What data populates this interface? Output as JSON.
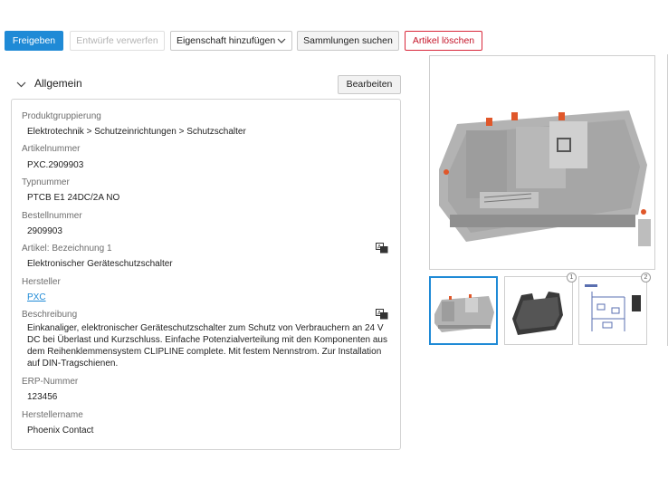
{
  "toolbar": {
    "release_label": "Freigeben",
    "discard_label": "Entwürfe verwerfen",
    "add_property_label": "Eigenschaft hinzufügen",
    "search_collections_label": "Sammlungen suchen",
    "delete_label": "Artikel löschen"
  },
  "section": {
    "title": "Allgemein",
    "edit_label": "Bearbeiten"
  },
  "fields": [
    {
      "label": "Produktgruppierung",
      "value": "Elektrotechnik > Schutzeinrichtungen > Schutzschalter"
    },
    {
      "label": "Artikelnummer",
      "value": "PXC.2909903"
    },
    {
      "label": "Typnummer",
      "value": "PTCB E1 24DC/2A NO"
    },
    {
      "label": "Bestellnummer",
      "value": "2909903"
    },
    {
      "label": "Artikel: Bezeichnung 1",
      "value": "Elektronischer Geräteschutzschalter"
    },
    {
      "label": "Hersteller",
      "value": "PXC"
    },
    {
      "label": "Beschreibung",
      "value": "Einkanaliger, elektronischer Geräteschutzschalter zum Schutz von Verbrauchern an 24 V DC bei Überlast und Kurzschluss. Einfache Potenzialverteilung mit den Komponenten aus dem Reihenklemmensystem CLIPLINE complete. Mit festem Nennstrom. Zur Installation auf DIN-Tragschienen."
    },
    {
      "label": "ERP-Nummer",
      "value": "123456"
    },
    {
      "label": "Herstellername",
      "value": "Phoenix Contact"
    }
  ],
  "thumbnails": [
    {
      "badge": ""
    },
    {
      "badge": "1"
    },
    {
      "badge": "2"
    }
  ],
  "colors": {
    "primary": "#1f8ad6",
    "danger": "#d9293b",
    "device_gray": "#a8a8a8",
    "terminal_orange": "#e0572a"
  }
}
